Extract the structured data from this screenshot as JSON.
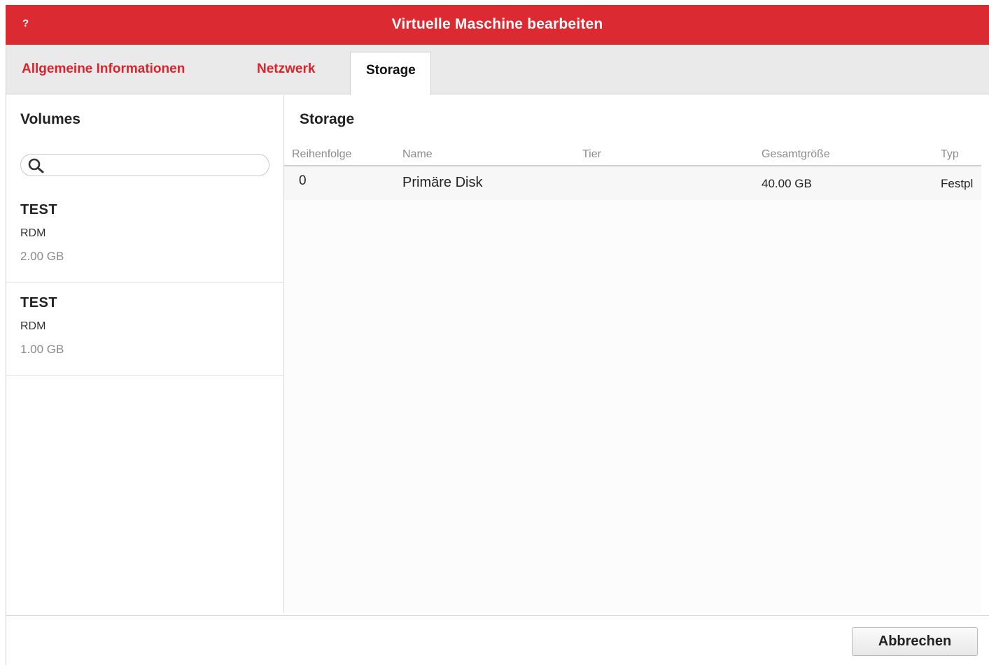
{
  "dialog": {
    "help_label": "?",
    "title": "Virtuelle Maschine bearbeiten",
    "accent_color": "#dc2a32"
  },
  "tabs": [
    {
      "label": "Allgemeine Informationen",
      "active": false
    },
    {
      "label": "Netzwerk",
      "active": false
    },
    {
      "label": "Storage",
      "active": true
    }
  ],
  "volumes_panel": {
    "heading": "Volumes",
    "search": {
      "value": "",
      "placeholder": "",
      "icon": "search-icon"
    },
    "items": [
      {
        "name": "TEST",
        "type": "RDM",
        "size": "2.00 GB"
      },
      {
        "name": "TEST",
        "type": "RDM",
        "size": "1.00 GB"
      }
    ]
  },
  "storage_panel": {
    "heading": "Storage",
    "columns": [
      "Reihenfolge",
      "Name",
      "Tier",
      "Gesamtgröße",
      "Typ"
    ],
    "rows": [
      {
        "order": "0",
        "name": "Primäre Disk",
        "tier": "",
        "size": "40.00 GB",
        "type": "Festpl"
      }
    ]
  },
  "footer": {
    "cancel_label": "Abbrechen"
  }
}
